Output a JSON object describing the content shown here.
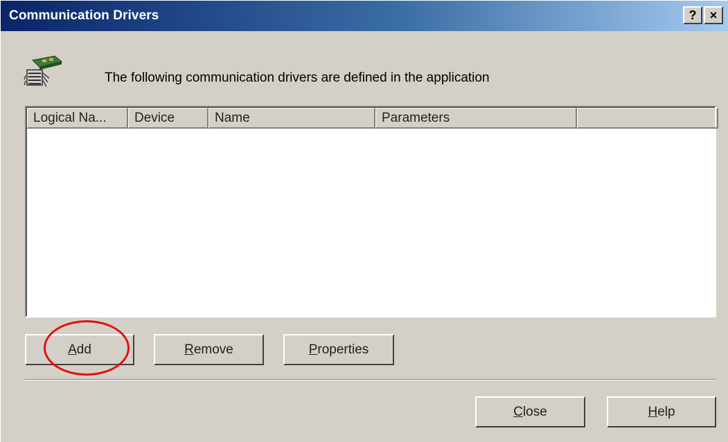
{
  "window": {
    "title": "Communication Drivers",
    "help_button": "?",
    "close_button": "×"
  },
  "description": "The following communication drivers are defined in the application",
  "list": {
    "columns": [
      "Logical Na...",
      "Device",
      "Name",
      "Parameters",
      ""
    ],
    "rows": []
  },
  "buttons": {
    "add": {
      "mnemonic": "A",
      "rest": "dd"
    },
    "remove": {
      "mnemonic": "R",
      "rest": "emove"
    },
    "properties": {
      "mnemonic": "P",
      "rest": "roperties"
    },
    "close": {
      "mnemonic": "C",
      "rest": "lose"
    },
    "help": {
      "mnemonic": "H",
      "rest": "elp"
    }
  },
  "colors": {
    "titlebar_start": "#0a246a",
    "titlebar_end": "#a6caf0",
    "face": "#d4d0c8",
    "highlight_circle": "#e01010"
  }
}
